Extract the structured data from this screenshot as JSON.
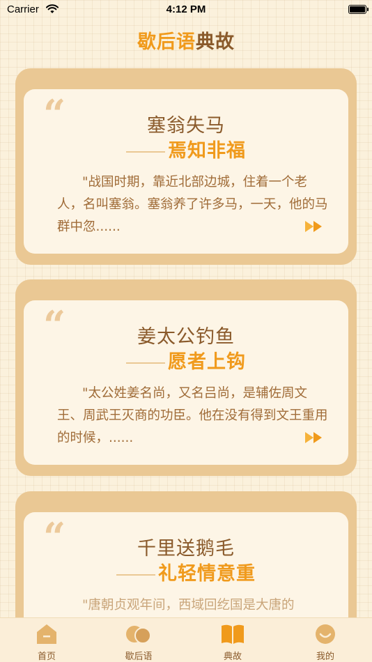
{
  "status_bar": {
    "carrier": "Carrier",
    "time": "4:12 PM"
  },
  "header": {
    "title_part1": "歇后语",
    "title_part2": "典故"
  },
  "cards": [
    {
      "title": "塞翁失马",
      "subtitle": "焉知非福",
      "excerpt": "\"战国时期，靠近北部边城，住着一个老人，名叫塞翁。塞翁养了许多马，一天，他的马群中忽......"
    },
    {
      "title": "姜太公钓鱼",
      "subtitle": "愿者上钩",
      "excerpt": "\"太公姓姜名尚，又名吕尚，是辅佐周文王、周武王灭商的功臣。他在没有得到文王重用的时候，......"
    },
    {
      "title": "千里送鹅毛",
      "subtitle": "礼轻情意重",
      "excerpt": "\"唐朝贞观年间，西域回纥国是大唐的"
    }
  ],
  "tabs": [
    {
      "label": "首页",
      "icon": "home-icon"
    },
    {
      "label": "歇后语",
      "icon": "chat-bubbles-icon"
    },
    {
      "label": "典故",
      "icon": "book-icon"
    },
    {
      "label": "我的",
      "icon": "smile-icon"
    }
  ],
  "colors": {
    "accent": "#f09a1c",
    "brown": "#8a5a2b",
    "card": "#eac894",
    "background": "#fbf1dc"
  }
}
